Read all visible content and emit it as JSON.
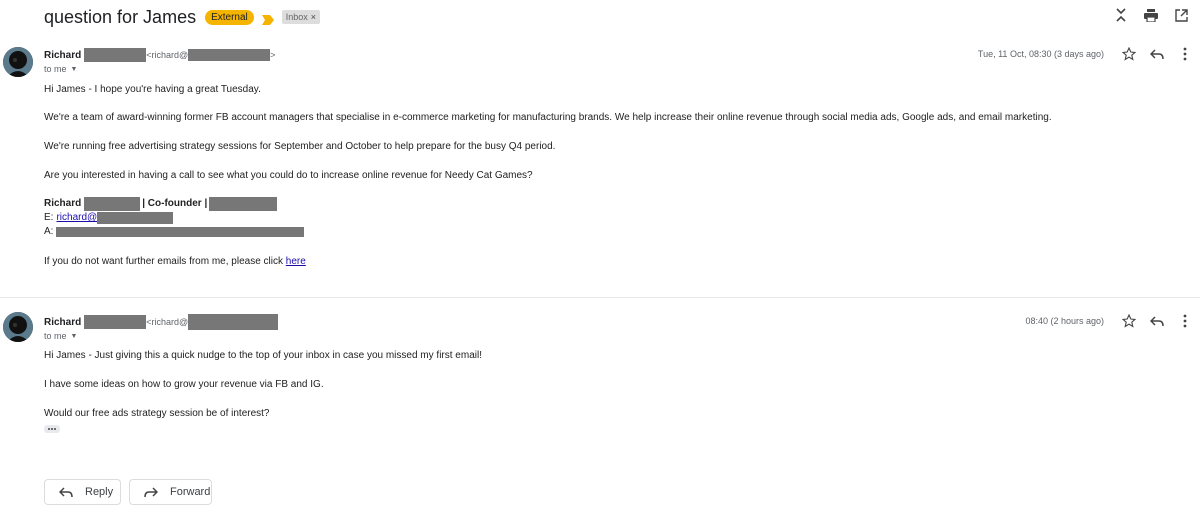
{
  "thread": {
    "subject": "question for James",
    "external_label": "External",
    "inbox_label": "Inbox",
    "inbox_remove": "×"
  },
  "toolbar": {
    "icons": [
      "collapse-all-icon",
      "print-icon",
      "open-in-new-window-icon"
    ]
  },
  "messages": [
    {
      "sender_name": "Richard",
      "email_prefix": "<richard@",
      "email_suffix": ">",
      "to_label": "to me",
      "date": "Tue, 11 Oct, 08:30 (3 days ago)",
      "body": {
        "greeting": "Hi James - I hope you're having a great Tuesday.",
        "p1": "We're a team of award-winning former FB account managers that specialise in e-commerce marketing for manufacturing brands. We help increase their online revenue through social media ads, Google ads, and email marketing.",
        "p2": "We're running free advertising strategy sessions for September and October to help prepare for the busy Q4 period.",
        "p3": "Are you interested in having a call to see what you could do to increase online revenue for Needy Cat Games?",
        "sig_name": "Richard",
        "sig_title": "| Co-founder |",
        "sig_email_label": "E:",
        "sig_email_prefix": "richard@",
        "sig_address_label": "A:",
        "unsubscribe_text": "If you do not want further emails from me, please click",
        "unsubscribe_link": "here"
      }
    },
    {
      "sender_name": "Richard",
      "email_prefix": "<richard@",
      "to_label": "to me",
      "date": "08:40 (2 hours ago)",
      "body": {
        "p1": "Hi James - Just giving this a quick nudge to the top of your inbox in case you missed my first email!",
        "p2": "I have some ideas on how to grow your revenue via FB and IG.",
        "p3": "Would our free ads strategy session be of interest?"
      }
    }
  ],
  "actions": {
    "reply_label": "Reply",
    "forward_label": "Forward"
  },
  "colors": {
    "external_badge": "#f4b400",
    "importance_marker": "#f4b400",
    "link": "#1a0dab",
    "redaction": "#777777"
  }
}
